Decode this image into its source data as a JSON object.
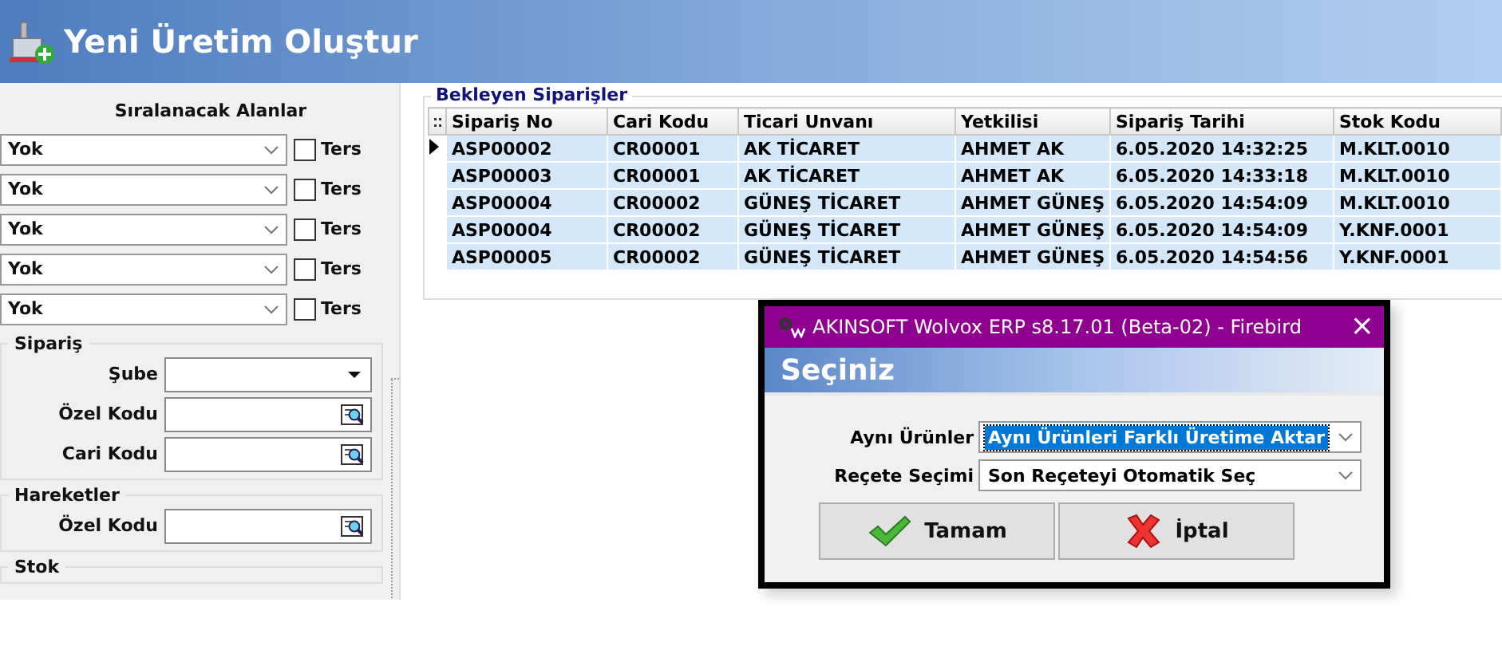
{
  "header": {
    "title": "Yeni Üretim Oluştur"
  },
  "sort": {
    "title": "Sıralanacak Alanlar",
    "rows": [
      {
        "value": "Yok",
        "label": "Ters",
        "checked": false
      },
      {
        "value": "Yok",
        "label": "Ters",
        "checked": false
      },
      {
        "value": "Yok",
        "label": "Ters",
        "checked": false
      },
      {
        "value": "Yok",
        "label": "Ters",
        "checked": false
      },
      {
        "value": "Yok",
        "label": "Ters",
        "checked": false
      }
    ]
  },
  "groups": [
    {
      "title": "Sipariş",
      "fields": [
        {
          "label": "Şube",
          "kind": "dropdown"
        },
        {
          "label": "Özel Kodu",
          "kind": "lookup"
        },
        {
          "label": "Cari Kodu",
          "kind": "lookup"
        }
      ]
    },
    {
      "title": "Hareketler",
      "fields": [
        {
          "label": "Özel Kodu",
          "kind": "lookup"
        }
      ]
    },
    {
      "title": "Stok"
    }
  ],
  "orders": {
    "title": "Bekleyen Siparişler",
    "columns": [
      "Sipariş No",
      "Cari Kodu",
      "Ticari Unvanı",
      "Yetkilisi",
      "Sipariş Tarihi",
      "Stok Kodu"
    ],
    "rows": [
      {
        "cells": [
          "ASP00002",
          "CR00001",
          "AK TİCARET",
          "AHMET AK",
          "6.05.2020 14:32:25",
          "M.KLT.0010"
        ],
        "current": true,
        "selected": true
      },
      {
        "cells": [
          "ASP00003",
          "CR00001",
          "AK TİCARET",
          "AHMET AK",
          "6.05.2020 14:33:18",
          "M.KLT.0010"
        ],
        "current": false,
        "selected": true
      },
      {
        "cells": [
          "ASP00004",
          "CR00002",
          "GÜNEŞ TİCARET",
          "AHMET GÜNEŞ",
          "6.05.2020 14:54:09",
          "M.KLT.0010"
        ],
        "current": false,
        "selected": true
      },
      {
        "cells": [
          "ASP00004",
          "CR00002",
          "GÜNEŞ TİCARET",
          "AHMET GÜNEŞ",
          "6.05.2020 14:54:09",
          "Y.KNF.0001"
        ],
        "current": false,
        "selected": true
      },
      {
        "cells": [
          "ASP00005",
          "CR00002",
          "GÜNEŞ TİCARET",
          "AHMET GÜNEŞ",
          "6.05.2020 14:54:56",
          "Y.KNF.0001"
        ],
        "current": false,
        "selected": true
      }
    ]
  },
  "dialog": {
    "title": "AKINSOFT Wolvox ERP s8.17.01 (Beta-02) - Firebird",
    "close": "×",
    "heading": "Seçiniz",
    "fields": [
      {
        "label": "Aynı Ürünler",
        "value": "Aynı Ürünleri Farklı Üretime Aktar",
        "highlighted": true
      },
      {
        "label": "Reçete Seçimi",
        "value": "Son Reçeteyi Otomatik Seç",
        "highlighted": false
      }
    ],
    "buttons": [
      {
        "label": "Tamam",
        "kind": "ok"
      },
      {
        "label": "İptal",
        "kind": "cancel"
      }
    ]
  }
}
